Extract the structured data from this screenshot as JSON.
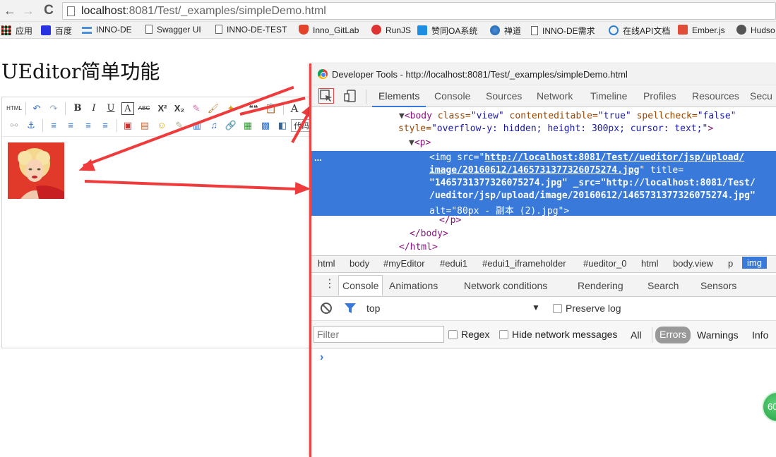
{
  "browser": {
    "url_host": "localhost",
    "url_rest": ":8081/Test/_examples/simpleDemo.html",
    "back_glyph": "←",
    "forward_glyph": "→",
    "reload_glyph": "C"
  },
  "bookmarks": [
    {
      "label": "应用",
      "icon": "apps-grid-icon"
    },
    {
      "label": "百度",
      "icon": "baidu-paw-icon"
    },
    {
      "label": "INNO-DE",
      "icon": "connector-icon"
    },
    {
      "label": "Swagger UI",
      "icon": "page-icon"
    },
    {
      "label": "INNO-DE-TEST",
      "icon": "page-icon"
    },
    {
      "label": "Inno_GitLab",
      "icon": "gitlab-fox-icon"
    },
    {
      "label": "RunJS",
      "icon": "runjs-icon"
    },
    {
      "label": "赞同OA系统",
      "icon": "oa-icon"
    },
    {
      "label": "禅道",
      "icon": "zentao-icon"
    },
    {
      "label": "INNO-DE需求",
      "icon": "page-icon"
    },
    {
      "label": "在线API文档",
      "icon": "api-doc-icon"
    },
    {
      "label": "Ember.js",
      "icon": "ember-icon"
    },
    {
      "label": "Hudso",
      "icon": "hudson-icon"
    }
  ],
  "page": {
    "heading": "UEditor简单功能"
  },
  "editor": {
    "toolbar_row1": [
      "HTML",
      "↶",
      "↷",
      "B",
      "I",
      "U",
      "A",
      "ABC",
      "X²",
      "X₂",
      "✎",
      "🖌",
      "✦",
      "❝❝",
      "📋",
      "A"
    ],
    "toolbar_row2": [
      "⚯",
      "⚓",
      "≡",
      "≡",
      "≡",
      "≡",
      "▣",
      "▤",
      "☺",
      "✎",
      "▥",
      "♫",
      "🔗",
      "▦",
      "▩",
      "◧",
      "代码"
    ]
  },
  "devtools": {
    "title": "Developer Tools - http://localhost:8081/Test/_examples/simpleDemo.html",
    "tabs": [
      "Elements",
      "Console",
      "Sources",
      "Network",
      "Timeline",
      "Profiles",
      "Resources",
      "Secu"
    ],
    "active_tab": "Elements",
    "dom": {
      "body_open_1": "<body",
      "body_attr_class": " class=",
      "body_val_class": "\"view\"",
      "body_attr_ce": " contenteditable=",
      "body_val_ce": "\"true\"",
      "body_attr_sc": " spellcheck=",
      "body_val_sc": "\"false\"",
      "style_attr": "style=",
      "style_val": "\"overflow-y: hidden; height: 300px; cursor: text;\"",
      "body_close_bracket": ">",
      "p_open": "<p>",
      "ellipsis": "...",
      "img_line1_a": "<img src=\"",
      "img_line1_b": "http://localhost:8081/Test//ueditor/jsp/upload/",
      "img_line2_a": "image/20160612/1465731377326075274.jpg",
      "img_line2_b": "\" title=",
      "img_line3": "\"1465731377326075274.jpg\" _src=\"http://localhost:8081/Test/",
      "img_line4": "/ueditor/jsp/upload/image/20160612/1465731377326075274.jpg\"",
      "img_line5": "alt=\"80px - 副本 (2).jpg\">",
      "p_close": "</p>",
      "body_close": "</body>",
      "html_close": "</html>"
    },
    "breadcrumbs": [
      "html",
      "body",
      "#myEditor",
      "#edui1",
      "#edui1_iframeholder",
      "#ueditor_0",
      "html",
      "body.view",
      "p",
      "img"
    ],
    "drawer_tabs": [
      "Console",
      "Animations",
      "Network conditions",
      "Rendering",
      "Search",
      "Sensors"
    ],
    "console": {
      "context": "top",
      "preserve_log": "Preserve log",
      "filter_placeholder": "Filter",
      "regex": "Regex",
      "hide_network": "Hide network messages",
      "levels": [
        "All",
        "Errors",
        "Warnings",
        "Info"
      ],
      "prompt": "›"
    }
  },
  "badge_text": "60"
}
